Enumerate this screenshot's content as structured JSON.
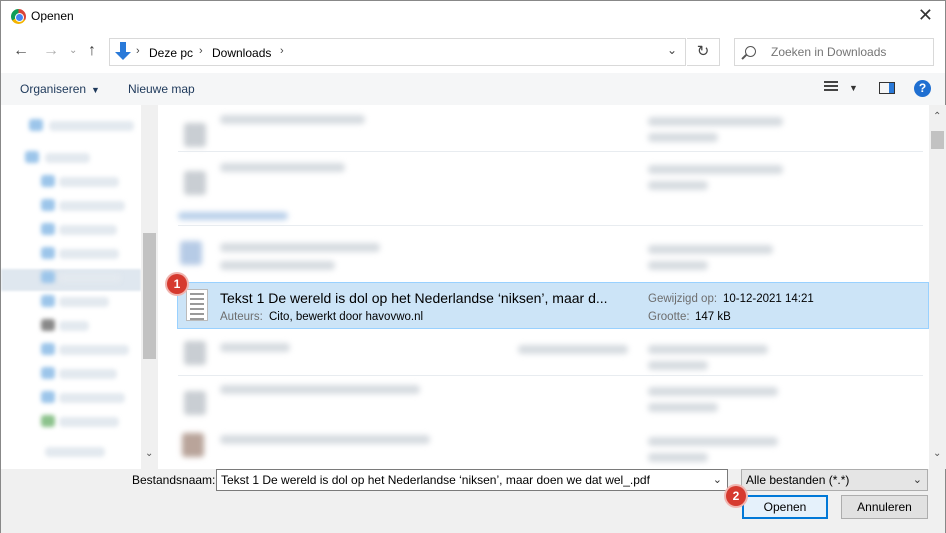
{
  "window": {
    "title": "Openen",
    "app_icon": "chrome-icon",
    "close": "✕"
  },
  "address": {
    "crumbs": [
      "Deze pc",
      "Downloads"
    ],
    "separator": "›"
  },
  "search": {
    "placeholder": "Zoeken in Downloads"
  },
  "toolbar": {
    "organise_label": "Organiseren",
    "new_folder_label": "Nieuwe map",
    "help_label": "?"
  },
  "selected_file": {
    "title": "Tekst 1 De wereld is dol op het Nederlandse ‘niksen’, maar d...",
    "authors_label": "Auteurs:",
    "authors": "Cito, bewerkt door havovwo.nl",
    "modified_label": "Gewijzigd op:",
    "modified": "10-12-2021 14:21",
    "size_label": "Grootte:",
    "size": "147 kB"
  },
  "markers": [
    "1",
    "2"
  ],
  "bottom": {
    "filename_label": "Bestandsnaam:",
    "filename_value": "Tekst 1 De wereld is dol op het Nederlandse ‘niksen’, maar doen we dat wel_.pdf",
    "filter_value": "Alle bestanden (*.*)",
    "open_label": "Openen",
    "cancel_label": "Annuleren"
  },
  "colors": {
    "selection_bg": "#cce4f7",
    "selection_border": "#99d1ff",
    "marker": "#d63a2f",
    "accent": "#0078d7"
  }
}
